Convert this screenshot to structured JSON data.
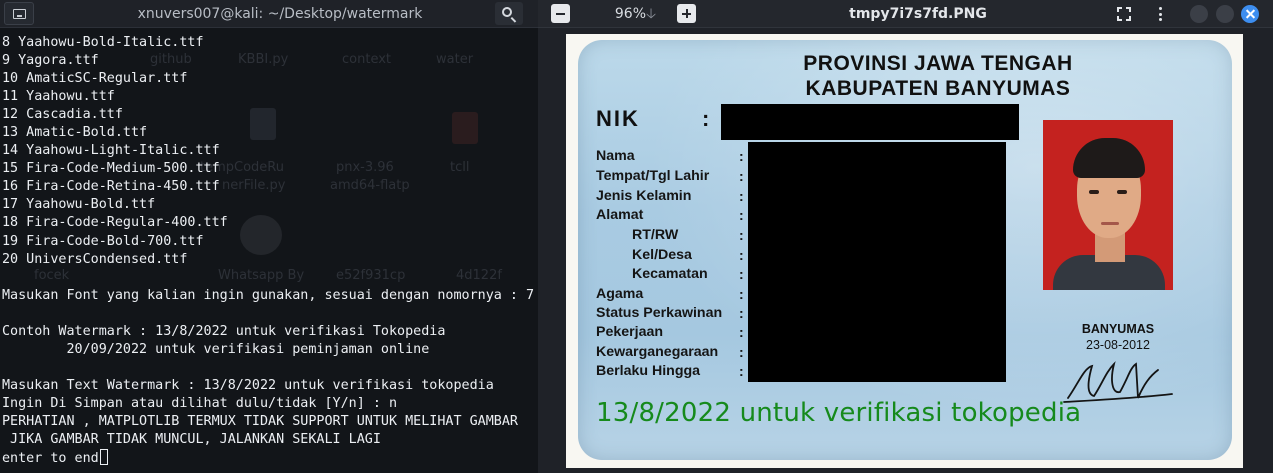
{
  "terminal": {
    "title": "xnuvers007@kali: ~/Desktop/watermark",
    "lines": [
      "8 Yaahowu-Bold-Italic.ttf",
      "9 Yagora.ttf",
      "10 AmaticSC-Regular.ttf",
      "11 Yaahowu.ttf",
      "12 Cascadia.ttf",
      "13 Amatic-Bold.ttf",
      "14 Yaahowu-Light-Italic.ttf",
      "15 Fira-Code-Medium-500.ttf",
      "16 Fira-Code-Retina-450.ttf",
      "17 Yaahowu-Bold.ttf",
      "18 Fira-Code-Regular-400.ttf",
      "19 Fira-Code-Bold-700.ttf",
      "20 UniversCondensed.ttf",
      "",
      "Masukan Font yang kalian ingin gunakan, sesuai dengan nomornya : 7",
      "",
      "Contoh Watermark : 13/8/2022 untuk verifikasi Tokopedia",
      "        20/09/2022 untuk verifikasi peminjaman online",
      "",
      "Masukan Text Watermark : 13/8/2022 untuk verifikasi tokopedia",
      "Ingin Di Simpan atau dilihat dulu/tidak [Y/n] : n",
      "PERHATIAN , MATPLOTLIB TERMUX TIDAK SUPPORT UNTUK MELIHAT GAMBAR",
      " JIKA GAMBAR TIDAK MUNCUL, JALANKAN SEKALI LAGI"
    ],
    "prompt_line": "enter to end",
    "icons": {
      "new_tab": "terminal-icon",
      "search": "search-icon"
    },
    "background_ghost_labels": [
      "github",
      "KBBI.py",
      "context",
      "water",
      "tempCodeRu",
      "nerFile.py",
      "pnx-3.96",
      "amd64-flatp",
      "tcll",
      "focek",
      "Whatsapp By",
      "e52f931cp",
      "4d122f"
    ]
  },
  "viewer": {
    "zoom": "96%",
    "title": "tmpy7i7s7fd.PNG",
    "accent": "#3d8ef0",
    "icons": {
      "zoom_out": "minus-icon",
      "zoom_in": "plus-icon",
      "zoom_menu": "arrow-down-icon",
      "fullscreen": "fullscreen-icon",
      "menu": "kebab-menu-icon",
      "close": "close-icon"
    }
  },
  "card": {
    "header_line1": "PROVINSI JAWA TENGAH",
    "header_line2": "KABUPATEN BANYUMAS",
    "nik_label": "NIK",
    "colon": ":",
    "fields": [
      "Nama",
      "Tempat/Tgl Lahir",
      "Jenis Kelamin",
      "Alamat",
      "RT/RW",
      "Kel/Desa",
      "Kecamatan",
      "Agama",
      "Status Perkawinan",
      "Pekerjaan",
      "Kewarganegaraan",
      "Berlaku Hingga"
    ],
    "city": "BANYUMAS",
    "issue_date": "23-08-2012",
    "watermark": "13/8/2022 untuk verifikasi tokopedia",
    "watermark_color": "#168a1c"
  }
}
